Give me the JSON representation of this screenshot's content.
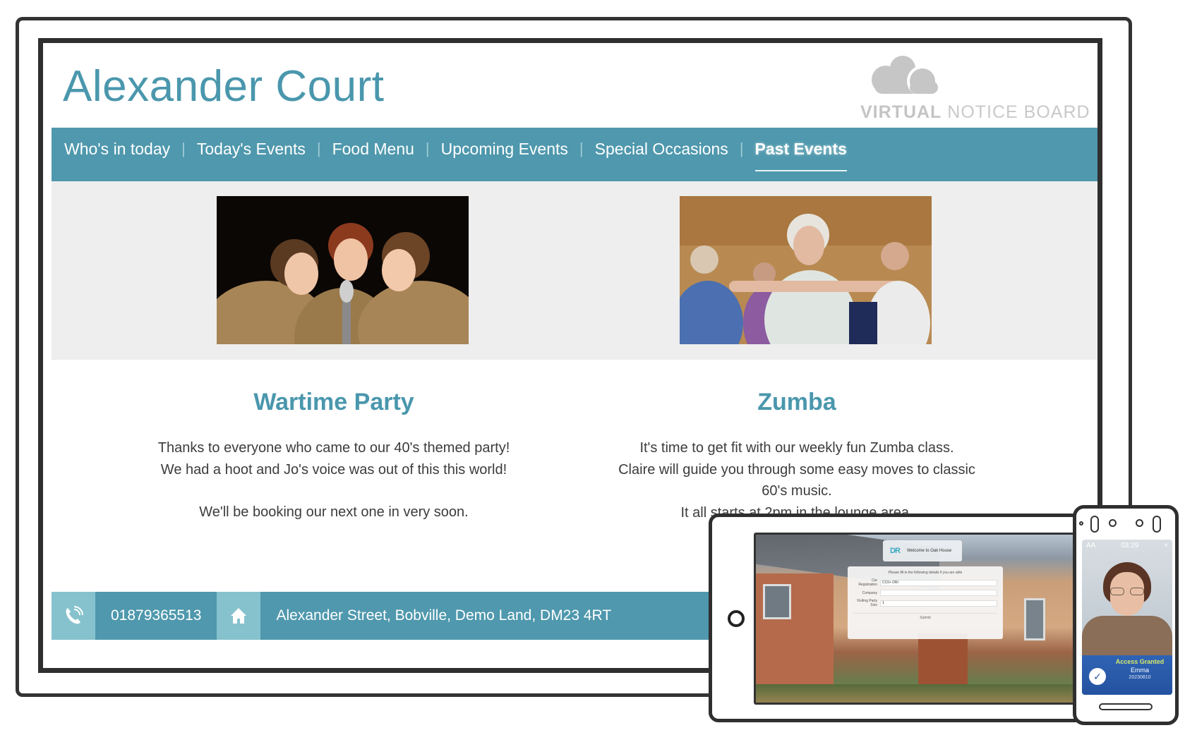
{
  "site": {
    "title": "Alexander Court",
    "logo": {
      "icon": "cloud-icon",
      "brand_bold": "VIRTUAL",
      "brand_light": " NOTICE BOARD"
    }
  },
  "nav": {
    "items": [
      {
        "label": "Who's in today",
        "active": false
      },
      {
        "label": "Today's Events",
        "active": false
      },
      {
        "label": "Food Menu",
        "active": false
      },
      {
        "label": "Upcoming Events",
        "active": false
      },
      {
        "label": "Special Occasions",
        "active": false
      },
      {
        "label": "Past Events",
        "active": true
      }
    ],
    "separator": "|"
  },
  "gallery": {
    "photos": [
      {
        "alt": "Three singers in wartime uniforms at a vintage microphone"
      },
      {
        "alt": "Seniors doing seated Zumba exercise"
      }
    ]
  },
  "events": [
    {
      "title": "Wartime Party",
      "lines": [
        "Thanks to everyone who came to our 40's themed party!",
        "We had a hoot and Jo's voice was out of this this world!",
        "We'll be booking our next one in very soon."
      ]
    },
    {
      "title": "Zumba",
      "lines": [
        "It's time to get fit with our weekly fun Zumba class.",
        "Claire will guide you through some easy moves to classic",
        "60's music.",
        "It all starts at 2pm in the lounge area."
      ]
    }
  ],
  "footer": {
    "phone_icon": "phone-icon",
    "phone": "01879365513",
    "home_icon": "home-icon",
    "address": "Alexander Street, Bobville, Demo Land, DM23 4RT"
  },
  "tablet": {
    "welcome": "Welcome to Oak House",
    "logo_text": "DR",
    "form_hint": "Please fill in the following details if you are able",
    "fields": [
      {
        "label": "Car Registration",
        "value": "CC0+ DRI"
      },
      {
        "label": "Company",
        "value": ""
      },
      {
        "label": "Visiting Party Size",
        "value": "1"
      }
    ],
    "submit_label": "Submit"
  },
  "face_device": {
    "status_left": "AA",
    "time": "03:29",
    "close": "×",
    "access_status": "Access Granted",
    "name": "Emma",
    "id": "20230810",
    "colors": {
      "band": "#2452a0",
      "status_text": "#d8e86a"
    }
  },
  "colors": {
    "brand_teal": "#4f98ad",
    "title_teal": "#4a97ad",
    "footer_icon_bg": "#86c2cd",
    "gallery_bg": "#eeeeee"
  }
}
